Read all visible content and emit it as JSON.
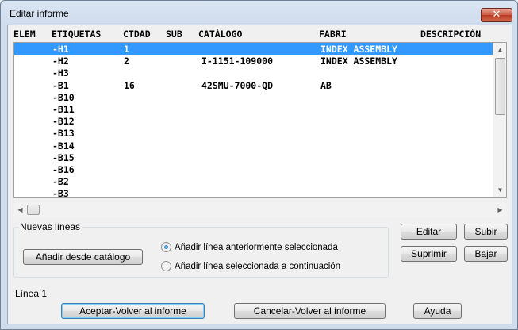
{
  "window": {
    "title": "Editar informe",
    "close_glyph": "✕"
  },
  "table": {
    "columns": [
      "ELEM",
      "ETIQUETAS",
      "CTDAD",
      "SUB",
      "CATÁLOGO",
      "FABRI",
      "DESCRIPCIÓN"
    ],
    "selected_row": 0,
    "rows": [
      {
        "elem": "",
        "etiqueta": "-H1",
        "ctdad": "1",
        "sub": "",
        "catalogo": "",
        "fabri": "INDEX ASSEMBLY",
        "descripcion": ""
      },
      {
        "elem": "",
        "etiqueta": "-H2",
        "ctdad": "2",
        "sub": "",
        "catalogo": "I-1151-109000",
        "fabri": "INDEX ASSEMBLY",
        "descripcion": ""
      },
      {
        "elem": "",
        "etiqueta": "-H3",
        "ctdad": "",
        "sub": "",
        "catalogo": "",
        "fabri": "",
        "descripcion": ""
      },
      {
        "elem": "",
        "etiqueta": "-B1",
        "ctdad": "16",
        "sub": "",
        "catalogo": "42SMU-7000-QD",
        "fabri": "AB",
        "descripcion": ""
      },
      {
        "elem": "",
        "etiqueta": "-B10",
        "ctdad": "",
        "sub": "",
        "catalogo": "",
        "fabri": "",
        "descripcion": ""
      },
      {
        "elem": "",
        "etiqueta": "-B11",
        "ctdad": "",
        "sub": "",
        "catalogo": "",
        "fabri": "",
        "descripcion": ""
      },
      {
        "elem": "",
        "etiqueta": "-B12",
        "ctdad": "",
        "sub": "",
        "catalogo": "",
        "fabri": "",
        "descripcion": ""
      },
      {
        "elem": "",
        "etiqueta": "-B13",
        "ctdad": "",
        "sub": "",
        "catalogo": "",
        "fabri": "",
        "descripcion": ""
      },
      {
        "elem": "",
        "etiqueta": "-B14",
        "ctdad": "",
        "sub": "",
        "catalogo": "",
        "fabri": "",
        "descripcion": ""
      },
      {
        "elem": "",
        "etiqueta": "-B15",
        "ctdad": "",
        "sub": "",
        "catalogo": "",
        "fabri": "",
        "descripcion": ""
      },
      {
        "elem": "",
        "etiqueta": "-B16",
        "ctdad": "",
        "sub": "",
        "catalogo": "",
        "fabri": "",
        "descripcion": ""
      },
      {
        "elem": "",
        "etiqueta": "-B2",
        "ctdad": "",
        "sub": "",
        "catalogo": "",
        "fabri": "",
        "descripcion": ""
      },
      {
        "elem": "",
        "etiqueta": "-B3",
        "ctdad": "",
        "sub": "",
        "catalogo": "",
        "fabri": "",
        "descripcion": ""
      }
    ]
  },
  "group": {
    "legend": "Nuevas líneas",
    "add_from_catalog": "Añadir desde catálogo",
    "radio_previous": "Añadir línea anteriormente seleccionada",
    "radio_next": "Añadir línea seleccionada a continuación",
    "radio_selected": "previous"
  },
  "side_buttons": {
    "edit": "Editar",
    "up": "Subir",
    "delete": "Suprimir",
    "down": "Bajar"
  },
  "status": {
    "line": "Línea 1"
  },
  "footer": {
    "accept": "Aceptar-Volver al informe",
    "cancel": "Cancelar-Volver al informe",
    "help": "Ayuda"
  },
  "icons": {
    "scroll_up": "▲",
    "scroll_down": "▼",
    "scroll_left": "◀",
    "scroll_right": "▶"
  },
  "colors": {
    "selection": "#3399ff"
  }
}
